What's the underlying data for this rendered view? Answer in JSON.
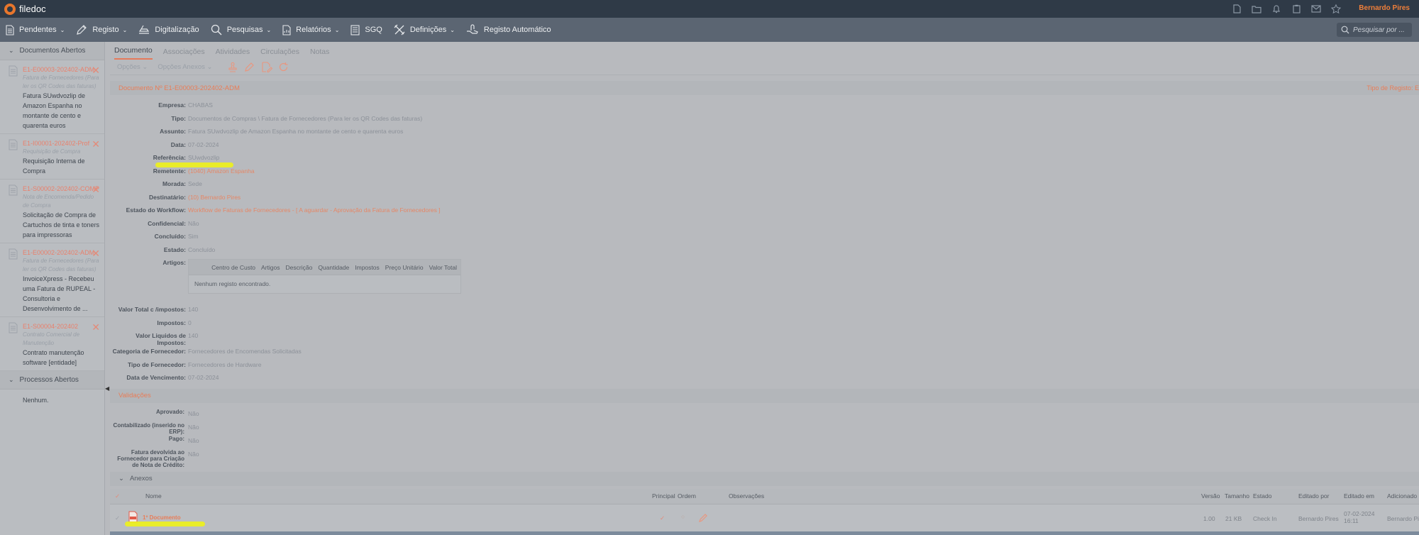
{
  "app": {
    "name": "filedoc",
    "user": "Bernardo Pires"
  },
  "menu": [
    {
      "label": "Pendentes",
      "chevron": true,
      "icon": "document-icon"
    },
    {
      "label": "Registo",
      "chevron": true,
      "icon": "pencil-icon"
    },
    {
      "label": "Digitalização",
      "chevron": false,
      "icon": "scanner-icon"
    },
    {
      "label": "Pesquisas",
      "chevron": true,
      "icon": "search-icon"
    },
    {
      "label": "Relatórios",
      "chevron": true,
      "icon": "report-icon"
    },
    {
      "label": "SGQ",
      "chevron": false,
      "icon": "checklist-icon"
    },
    {
      "label": "Definições",
      "chevron": true,
      "icon": "tools-icon"
    },
    {
      "label": "Registo Automático",
      "chevron": false,
      "icon": "hand-icon"
    }
  ],
  "search": {
    "placeholder": "Pesquisar por ..."
  },
  "sidebar": {
    "open_docs_title": "Documentos Abertos",
    "docs": [
      {
        "id": "E1-E00003-202402-ADM",
        "type": "Fatura de Fornecedores (Para ler os QR Codes das faturas)",
        "desc": "Fatura SUwdvozlip de Amazon Espanha no montante de cento e quarenta euros"
      },
      {
        "id": "E1-I00001-202402-Prof",
        "type": "Requisição de Compra",
        "desc": "Requisição Interna de Compra"
      },
      {
        "id": "E1-S00002-202402-COMP",
        "type": "Nota de Encomenda/Pedido de Compra",
        "desc": "Solicitação de Compra de Cartuchos de tinta e toners para impressoras"
      },
      {
        "id": "E1-E00002-202402-ADM",
        "type": "Fatura de Fornecedores (Para ler os QR Codes das faturas)",
        "desc": "InvoiceXpress - Recebeu uma Fatura de RUPEAL - Consultoria e Desenvolvimento de ..."
      },
      {
        "id": "E1-S00004-202402",
        "type": "Contrato Comercial de Manutenção",
        "desc": "Contrato manutenção software [entidade]"
      }
    ],
    "processes_title": "Processos Abertos",
    "processes_empty": "Nenhum."
  },
  "tabs": [
    "Documento",
    "Associações",
    "Atividades",
    "Circulações",
    "Notas"
  ],
  "toolbar": {
    "opcoes": "Opções",
    "opcoes_anexos": "Opções Anexos"
  },
  "doc": {
    "title": "Documento Nº E1-E00003-202402-ADM",
    "tipo_registo": "Tipo de Registo: E",
    "fields": [
      {
        "label": "Empresa:",
        "value": "CHABAS",
        "link": false
      },
      {
        "label": "Tipo:",
        "value": "Documentos de Compras \\ Fatura de Fornecedores (Para ler os QR Codes das faturas)",
        "link": false
      },
      {
        "label": "Assunto:",
        "value": "Fatura SUwdvozlip de Amazon Espanha no montante de cento e quarenta euros",
        "link": false
      },
      {
        "label": "Data:",
        "value": "07-02-2024",
        "link": false
      },
      {
        "label": "Referência:",
        "value": "SUwdvozlip",
        "link": false
      },
      {
        "label": "Remetente:",
        "value": "(1040) Amazon Espanha",
        "link": true
      },
      {
        "label": "Morada:",
        "value": "Sede",
        "link": false
      },
      {
        "label": "Destinatário:",
        "value": "(10) Bernardo Pires",
        "link": true
      },
      {
        "label": "Estado do Workflow:",
        "value": "Workflow de Faturas de Fornecedores - [ A aguardar - Aprovação da Fatura de Fornecedores ]",
        "link": true
      },
      {
        "label": "Confidencial:",
        "value": "Não",
        "link": false
      },
      {
        "label": "Concluído:",
        "value": "Sim",
        "link": false
      },
      {
        "label": "Estado:",
        "value": "Concluído",
        "link": false
      }
    ],
    "artigos_label": "Artigos:",
    "artigos_cols": [
      "Centro de Custo",
      "Artigos",
      "Descrição",
      "Quantidade",
      "Impostos",
      "Preço Unitário",
      "Valor Total"
    ],
    "artigos_empty": "Nenhum registo encontrado.",
    "fields2": [
      {
        "label": "Valor Total c /impostos:",
        "value": "140"
      },
      {
        "label": "Impostos:",
        "value": "0"
      },
      {
        "label": "Valor Liquidos de Impostos:",
        "value": "140"
      },
      {
        "label": "Categoria de Fornecedor:",
        "value": "Fornecedores de Encomendas Solicitadas"
      },
      {
        "label": "Tipo de Fornecedor:",
        "value": "Fornecedores de Hardware"
      },
      {
        "label": "Data de Vencimento:",
        "value": "07-02-2024"
      }
    ]
  },
  "validacoes": {
    "title": "Validações",
    "rows": [
      {
        "label": "Aprovado:",
        "value": "Não"
      },
      {
        "label": "Contabilizado (inserido no ERP):",
        "value": "Não"
      },
      {
        "label": "Pago:",
        "value": "Não"
      },
      {
        "label": "Fatura devolvida ao Fornecedor para Criação de Nota de Crédito:",
        "value": "Não"
      }
    ]
  },
  "anexos": {
    "title": "Anexos",
    "cols": {
      "nome": "Nome",
      "principal": "Principal",
      "ordem": "Ordem",
      "observacoes": "Observações",
      "versao": "Versão",
      "tamanho": "Tamanho",
      "estado": "Estado",
      "editado_por": "Editado por",
      "editado_em": "Editado em",
      "adicionado": "Adicionado"
    },
    "row": {
      "nome": "1º Documento",
      "versao": "1.00",
      "tamanho": "21 KB",
      "estado": "Check In",
      "editado_por": "Bernardo Pires",
      "editado_em": "07-02-2024 16:11",
      "adicionado": "Bernardo Pir"
    }
  },
  "colors": {
    "accent": "#e87d58",
    "topbar": "#2f3a47",
    "menubar": "#5b6572",
    "highlight": "#eef21a"
  }
}
